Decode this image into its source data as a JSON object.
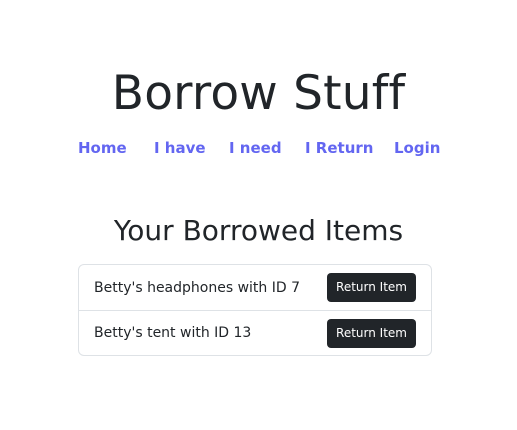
{
  "header": {
    "title": "Borrow Stuff"
  },
  "nav": {
    "items": [
      {
        "label": "Home"
      },
      {
        "label": "I have"
      },
      {
        "label": "I need"
      },
      {
        "label": "I Return"
      },
      {
        "label": "Login"
      }
    ],
    "link_color": "#6366f1"
  },
  "main": {
    "section_title": "Your Borrowed Items",
    "items": [
      {
        "text": "Betty's headphones with ID 7",
        "button_label": "Return Item"
      },
      {
        "text": "Betty's tent with ID 13",
        "button_label": "Return Item"
      }
    ]
  }
}
